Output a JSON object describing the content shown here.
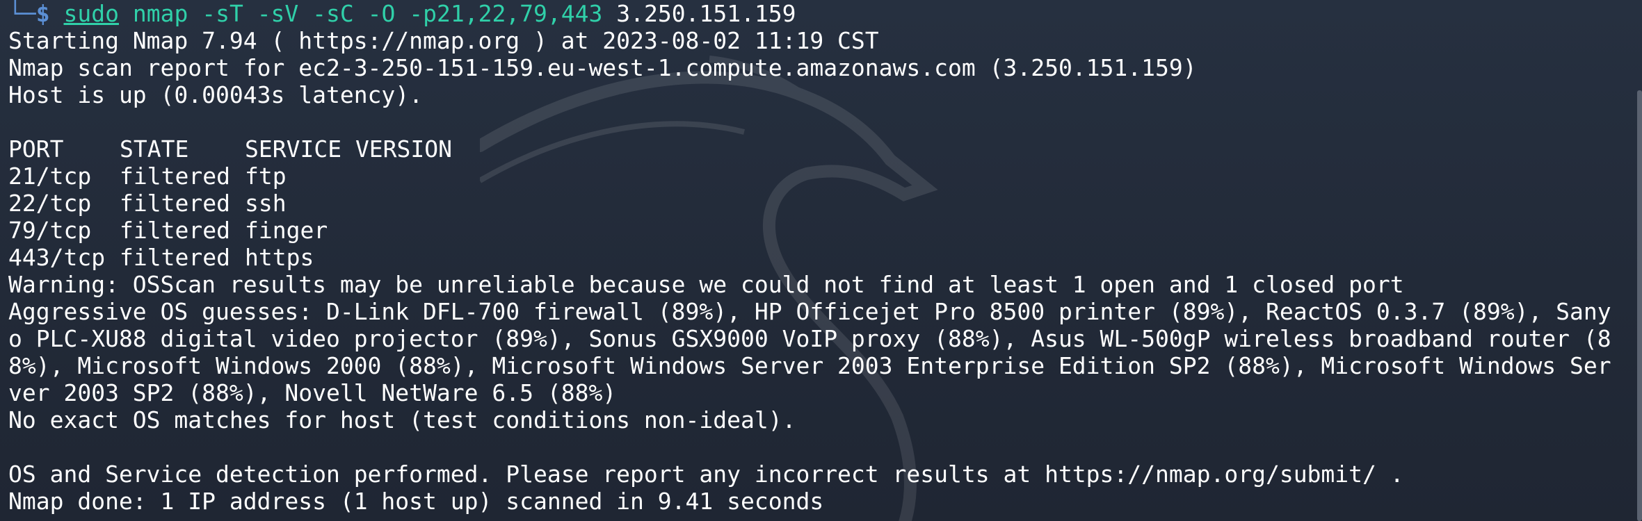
{
  "prompt": {
    "corner": "└─",
    "dollar": "$",
    "sudo": "sudo",
    "program": "nmap",
    "args": "-sT -sV -sC -O -p21,22,79,443",
    "target": "3.250.151.159"
  },
  "output": {
    "starting": "Starting Nmap 7.94 ( https://nmap.org ) at 2023-08-02 11:19 CST",
    "scan_report": "Nmap scan report for ec2-3-250-151-159.eu-west-1.compute.amazonaws.com (3.250.151.159)",
    "host_up": "Host is up (0.00043s latency).",
    "ports_header": {
      "port": "PORT",
      "state": "STATE",
      "service": "SERVICE VERSION"
    },
    "ports": [
      {
        "port": "21/tcp",
        "state": "filtered",
        "service": "ftp"
      },
      {
        "port": "22/tcp",
        "state": "filtered",
        "service": "ssh"
      },
      {
        "port": "79/tcp",
        "state": "filtered",
        "service": "finger"
      },
      {
        "port": "443/tcp",
        "state": "filtered",
        "service": "https"
      }
    ],
    "warning": "Warning: OSScan results may be unreliable because we could not find at least 1 open and 1 closed port",
    "os_guesses": [
      "Aggressive OS guesses: D-Link DFL-700 firewall (89%), HP Officejet Pro 8500 printer (89%), ReactOS 0.3.7 (89%), Sany",
      "o PLC-XU88 digital video projector (89%), Sonus GSX9000 VoIP proxy (88%), Asus WL-500gP wireless broadband router (8",
      "8%), Microsoft Windows 2000 (88%), Microsoft Windows Server 2003 Enterprise Edition SP2 (88%), Microsoft Windows Ser",
      "ver 2003 SP2 (88%), Novell NetWare 6.5 (88%)"
    ],
    "no_exact": "No exact OS matches for host (test conditions non-ideal).",
    "detection_done": "OS and Service detection performed. Please report any incorrect results at https://nmap.org/submit/ .",
    "nmap_done": "Nmap done: 1 IP address (1 host up) scanned in 9.41 seconds"
  },
  "colors": {
    "background": "#232a36",
    "prompt": "#5b8fd4",
    "command": "#30d0a9",
    "text": "#ffffff"
  },
  "icons": {
    "watermark": "kali-dragon-icon"
  }
}
